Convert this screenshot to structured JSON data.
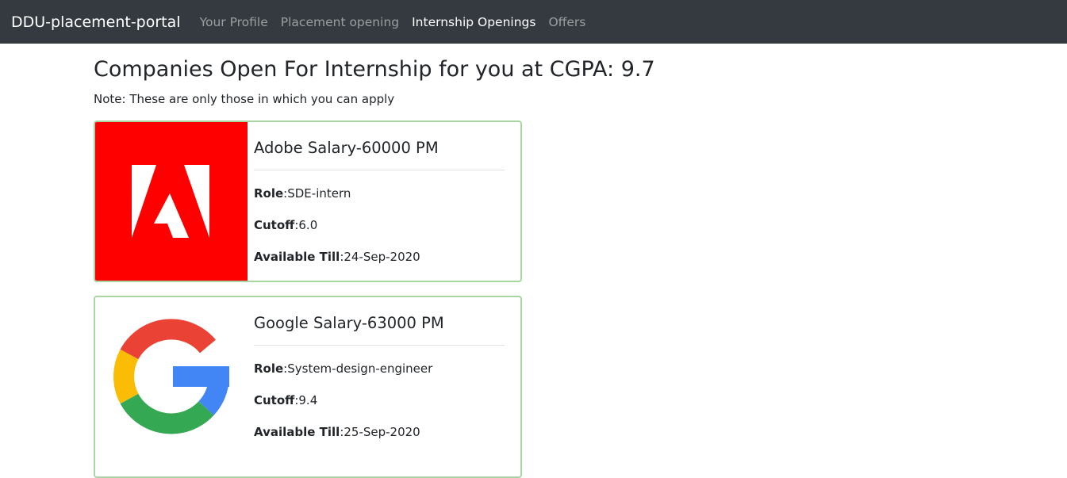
{
  "navbar": {
    "brand": "DDU-placement-portal",
    "links": [
      {
        "label": "Your Profile",
        "active": false
      },
      {
        "label": "Placement opening",
        "active": false
      },
      {
        "label": "Internship Openings",
        "active": true
      },
      {
        "label": "Offers",
        "active": false
      }
    ]
  },
  "page": {
    "title": "Companies Open For Internship for you at CGPA: 9.7",
    "note": "Note: These are only those in which you can apply"
  },
  "labels": {
    "role": "Role",
    "cutoff": "Cutoff",
    "till": "Available Till"
  },
  "companies": [
    {
      "title": "Adobe Salary-60000 PM",
      "logo": "adobe-logo",
      "role": ":SDE-intern",
      "cutoff": ":6.0",
      "till": ":24-Sep-2020"
    },
    {
      "title": "Google Salary-63000 PM",
      "logo": "google-logo",
      "role": ":System-design-engineer",
      "cutoff": ":9.4",
      "till": ":25-Sep-2020"
    }
  ],
  "colors": {
    "navbar_bg": "#343a40",
    "card_border": "#a8d5a2",
    "adobe_red": "#ff0000",
    "google_red": "#ea4335",
    "google_yellow": "#fbbc05",
    "google_green": "#34a853",
    "google_blue": "#4285f4"
  }
}
